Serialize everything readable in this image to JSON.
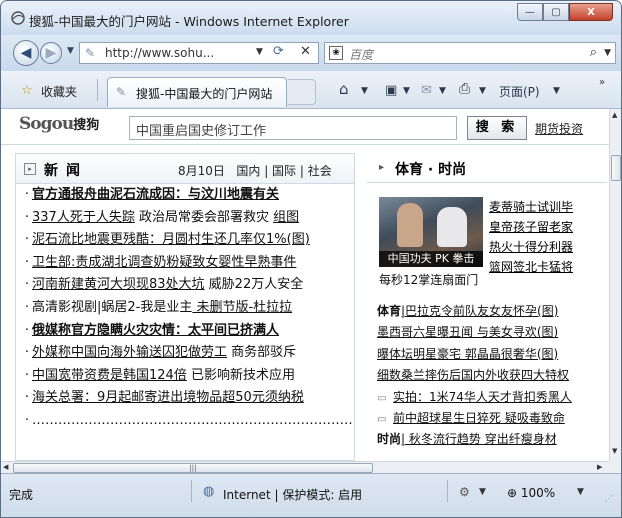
{
  "window": {
    "title": "搜狐-中国最大的门户网站 - Windows Internet Explorer",
    "minimize": "—",
    "maximize": "▢",
    "close": "X"
  },
  "nav": {
    "address": "http://www.sohu...",
    "search_placeholder": "百度"
  },
  "favbar": {
    "favorites_label": "收藏夹",
    "tab_label": "搜狐-中国最大的门户网站",
    "page_menu": "页面(P)",
    "more": "»"
  },
  "sogou": {
    "logo": "Sogou",
    "logo_cn": "搜狗",
    "query": "中国重启国史修订工作",
    "button": "搜 索",
    "link": "期货投资"
  },
  "news": {
    "title": "新闻",
    "date": "8月10日",
    "tabs": [
      "国内",
      "国际",
      "社会"
    ],
    "lines": [
      {
        "segments": [
          {
            "text": "官方通报舟曲泥石流成因：与汶川地震有关",
            "style": "u b"
          }
        ]
      },
      {
        "segments": [
          {
            "text": "337人死于人失踪",
            "style": "u"
          },
          {
            "text": " 政治局常委会部署救灾 ",
            "style": ""
          },
          {
            "text": "组图",
            "style": "u"
          }
        ]
      },
      {
        "segments": [
          {
            "text": "泥石流比地震更残酷：月圆村生还几率仅1%(图)",
            "style": "u"
          }
        ]
      },
      {
        "segments": [
          {
            "text": "卫生部:责成湖北调查奶粉疑致女婴性早熟事件",
            "style": "u"
          }
        ]
      },
      {
        "segments": [
          {
            "text": "河南新建黄河大坝现83处大坑",
            "style": "u"
          },
          {
            "text": " 威胁22万人安全",
            "style": ""
          }
        ]
      },
      {
        "segments": [
          {
            "text": "高清影视剧|蜗居2-我是业主",
            "style": ""
          },
          {
            "text": " 未删节版-杜拉拉",
            "style": "u"
          }
        ]
      },
      {
        "segments": [
          {
            "text": "俄媒称官方隐瞒火灾灾情：太平间已挤满人",
            "style": "u b"
          }
        ]
      },
      {
        "segments": [
          {
            "text": "外媒称中国向海外输送囚犯做劳工",
            "style": "u"
          },
          {
            "text": " 商务部驳斥",
            "style": ""
          }
        ]
      },
      {
        "segments": [
          {
            "text": "中国宽带资费是韩国124倍",
            "style": "u"
          },
          {
            "text": " 已影响新技术应用",
            "style": ""
          }
        ]
      },
      {
        "segments": [
          {
            "text": "海关总署：9月起邮寄进出境物品超50元须纳税",
            "style": "u"
          }
        ]
      },
      {
        "segments": [
          {
            "text": "…………………………………………………………………",
            "style": ""
          }
        ]
      }
    ]
  },
  "sports": {
    "title": "体育 · 时尚",
    "photo_caption": "中国功夫 PK 拳击",
    "photo_sub": "每秒12掌连扇面门",
    "side_links": [
      "麦蒂骑士试训毕",
      "皇帝孩子留老家",
      "热火十得分利器",
      "篮网签北卡猛将"
    ],
    "lines": [
      {
        "segments": [
          {
            "text": "体育",
            "style": "b"
          },
          {
            "text": "|巴拉克令前队友女友怀孕(图)",
            "style": "u"
          }
        ]
      },
      {
        "segments": [
          {
            "text": "墨西哥六星曝丑闻",
            "style": "u"
          },
          {
            "text": " 与美女寻欢(图)",
            "style": "u"
          }
        ]
      },
      {
        "segments": [
          {
            "text": "曝体坛明星豪宅",
            "style": "u"
          },
          {
            "text": " 郭晶晶很奢华(图)",
            "style": "u"
          }
        ]
      },
      {
        "segments": [
          {
            "text": "细数桑兰摔伤后国内外收获四大特权",
            "style": "u"
          }
        ]
      },
      {
        "segments": [
          {
            "icon": "video-icon",
            "text": "实拍：1米74华人天才背扣秀黑人",
            "style": "u"
          }
        ]
      },
      {
        "segments": [
          {
            "icon": "video-icon",
            "text": "前中超球星生日猝死  疑吸毒致命",
            "style": "u"
          }
        ]
      },
      {
        "segments": [
          {
            "text": "时尚",
            "style": "b"
          },
          {
            "text": "| 秋冬流行趋势 穿出纤瘦身材",
            "style": "u"
          }
        ]
      }
    ]
  },
  "status": {
    "done": "完成",
    "zone": "Internet | 保护模式: 启用",
    "zoom": "100%"
  }
}
